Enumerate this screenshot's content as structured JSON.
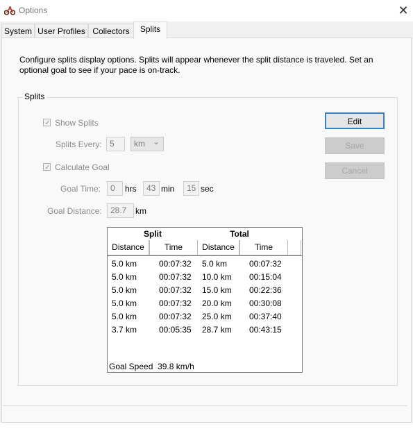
{
  "window": {
    "title": "Options",
    "icon": "motorcycle-icon",
    "close_glyph": "✕"
  },
  "tabs": [
    {
      "label": "System",
      "active": false
    },
    {
      "label": "User Profiles",
      "active": false
    },
    {
      "label": "Collectors",
      "active": false
    },
    {
      "label": "Splits",
      "active": true
    }
  ],
  "description": "Configure splits display options.  Splits will appear whenever the split distance is traveled.  Set an optional goal to see if your pace is on-track.",
  "group_title": "Splits",
  "show_splits": {
    "label": "Show Splits",
    "checked": true,
    "check_glyph": "✓"
  },
  "splits_every": {
    "label": "Splits Every:",
    "value": "5",
    "unit": "km",
    "chevron": "⌄"
  },
  "calculate_goal": {
    "label": "Calculate Goal",
    "checked": true,
    "check_glyph": "✓"
  },
  "goal_time": {
    "label": "Goal Time:",
    "hrs": "0",
    "hrs_unit": "hrs",
    "min": "43",
    "min_unit": "min",
    "sec": "15",
    "sec_unit": "sec"
  },
  "goal_distance": {
    "label": "Goal Distance:",
    "value": "28.7",
    "unit": "km"
  },
  "buttons": {
    "edit": "Edit",
    "save": "Save",
    "cancel": "Cancel"
  },
  "table": {
    "group_headers": {
      "split": "Split",
      "total": "Total"
    },
    "columns": [
      "Distance",
      "Time",
      "Distance",
      "Time"
    ],
    "rows": [
      [
        "5.0 km",
        "00:07:32",
        "5.0 km",
        "00:07:32"
      ],
      [
        "5.0 km",
        "00:07:32",
        "10.0 km",
        "00:15:04"
      ],
      [
        "5.0 km",
        "00:07:32",
        "15.0 km",
        "00:22:36"
      ],
      [
        "5.0 km",
        "00:07:32",
        "20.0 km",
        "00:30:08"
      ],
      [
        "5.0 km",
        "00:07:32",
        "25.0 km",
        "00:37:40"
      ],
      [
        "3.7 km",
        "00:05:35",
        "28.7 km",
        "00:43:15"
      ]
    ],
    "goal_speed_label": "Goal Speed",
    "goal_speed_value": "39.8 km/h"
  }
}
